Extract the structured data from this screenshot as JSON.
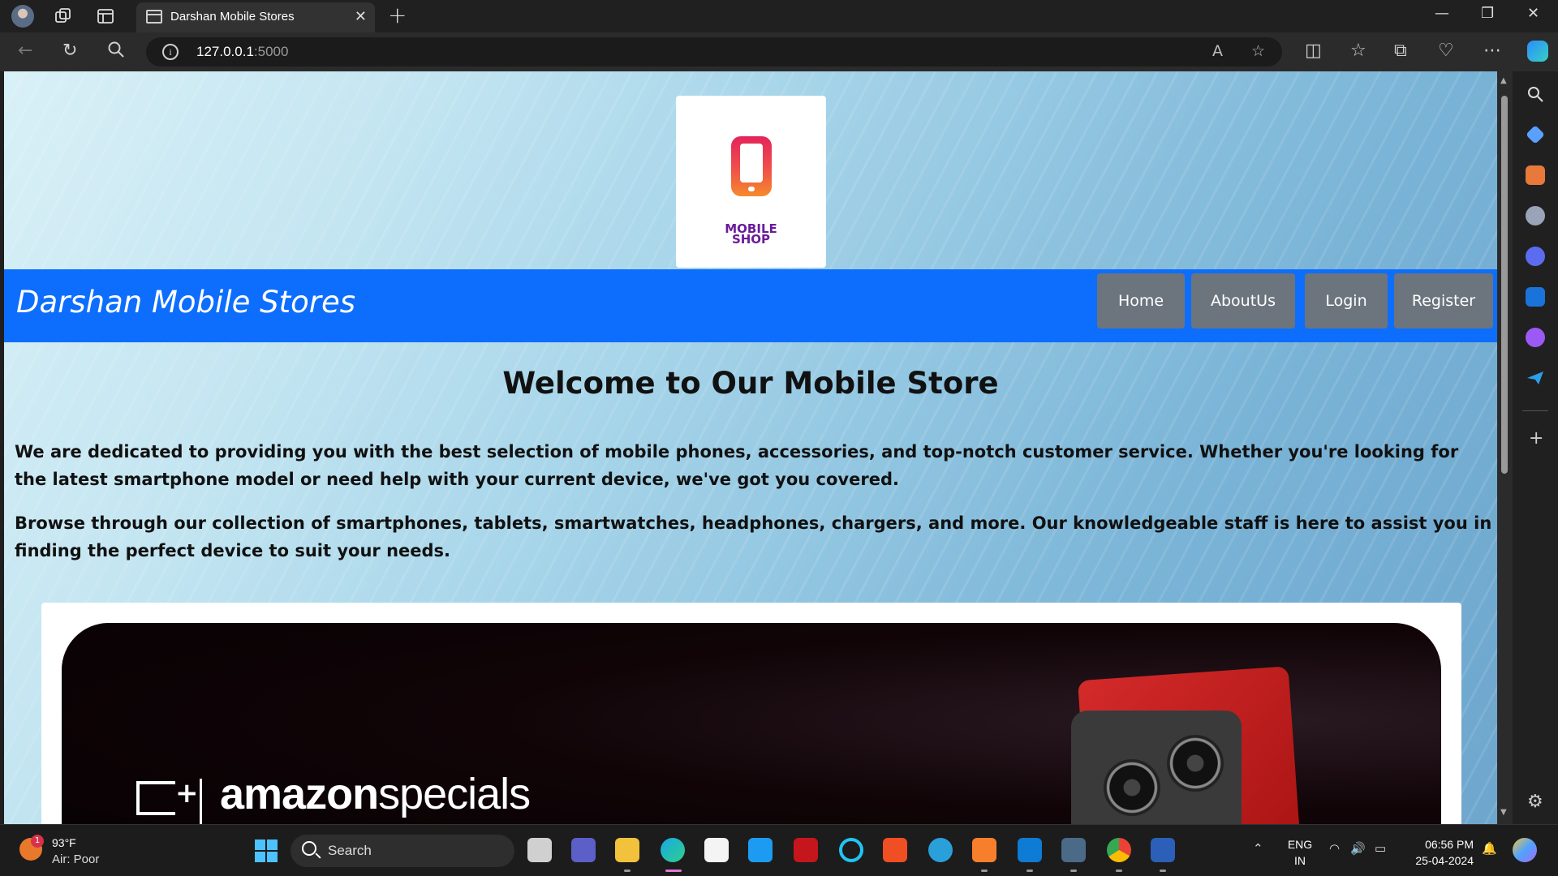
{
  "browser": {
    "tab_title": "Darshan Mobile Stores",
    "url_host": "127.0.0.1",
    "url_port": ":5000",
    "icons": [
      "profile-avatar",
      "workspaces-icon",
      "vertical-tabs-icon",
      "tab-favicon",
      "close-icon",
      "new-tab-icon",
      "minimize-icon",
      "maximize-icon",
      "close-window-icon",
      "back-icon",
      "refresh-icon",
      "search-icon",
      "info-icon",
      "read-aloud-icon",
      "favorite-star-icon",
      "split-screen-icon",
      "favorites-icon",
      "collections-icon",
      "browser-essentials-icon",
      "more-icon",
      "copilot-icon"
    ]
  },
  "site": {
    "logo_line1": "MOBILE",
    "logo_line2": "SHOP",
    "brand": "Darshan Mobile Stores",
    "nav": [
      "Home",
      "AboutUs",
      "Login",
      "Register"
    ],
    "heading": "Welcome to Our Mobile Store",
    "paragraph1": "We are dedicated to providing you with the best selection of mobile phones, accessories, and top-notch customer service. Whether you're looking for the latest smartphone model or need help with your current device, we've got you covered.",
    "paragraph2": "Browse through our collection of smartphones, tablets, smartwatches, headphones, chargers, and more. Our knowledgeable staff is here to assist you in finding the perfect device to suit your needs.",
    "banner_brand": "amazon",
    "banner_suffix": "specials",
    "colors": {
      "navbar": "#0d6efd",
      "nav_button": "#6c757d"
    }
  },
  "taskbar": {
    "weather_temp": "93°F",
    "weather_desc": "Air: Poor",
    "weather_badge": "1",
    "search_label": "Search",
    "lang_line1": "ENG",
    "lang_line2": "IN",
    "time": "06:56 PM",
    "date": "25-04-2024"
  }
}
